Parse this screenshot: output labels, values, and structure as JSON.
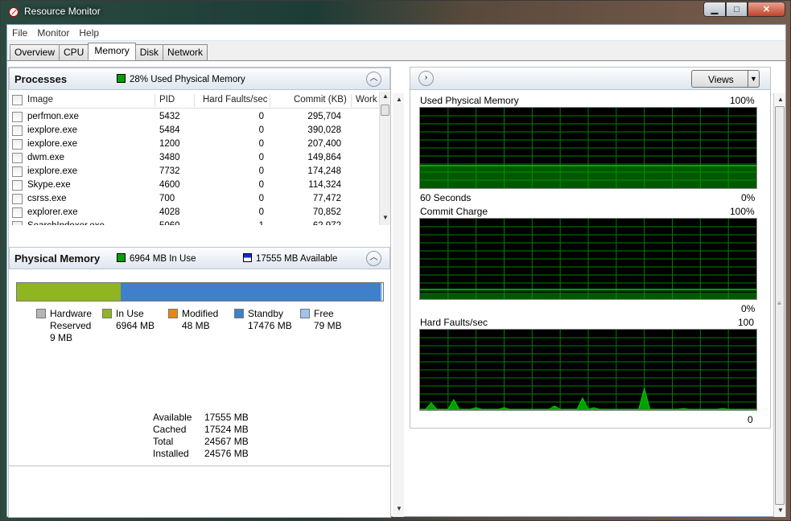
{
  "window": {
    "title": "Resource Monitor",
    "minimize": "▁",
    "maximize": "□",
    "close": "✕"
  },
  "menu": [
    "File",
    "Monitor",
    "Help"
  ],
  "tabs": [
    "Overview",
    "CPU",
    "Memory",
    "Disk",
    "Network"
  ],
  "active_tab": "Memory",
  "processes": {
    "title": "Processes",
    "summary": "28% Used Physical Memory",
    "summary_color": "#00a000",
    "columns": [
      "Image",
      "PID",
      "Hard Faults/sec",
      "Commit (KB)",
      "Work"
    ],
    "rows": [
      {
        "image": "perfmon.exe",
        "pid": "5432",
        "faults": "0",
        "commit": "295,704"
      },
      {
        "image": "iexplore.exe",
        "pid": "5484",
        "faults": "0",
        "commit": "390,028"
      },
      {
        "image": "iexplore.exe",
        "pid": "1200",
        "faults": "0",
        "commit": "207,400"
      },
      {
        "image": "dwm.exe",
        "pid": "3480",
        "faults": "0",
        "commit": "149,864"
      },
      {
        "image": "iexplore.exe",
        "pid": "7732",
        "faults": "0",
        "commit": "174,248"
      },
      {
        "image": "Skype.exe",
        "pid": "4600",
        "faults": "0",
        "commit": "114,324"
      },
      {
        "image": "csrss.exe",
        "pid": "700",
        "faults": "0",
        "commit": "77,472"
      },
      {
        "image": "explorer.exe",
        "pid": "4028",
        "faults": "0",
        "commit": "70,852"
      },
      {
        "image": "SearchIndexer.exe",
        "pid": "5060",
        "faults": "1",
        "commit": "62,972"
      }
    ]
  },
  "physical_memory": {
    "title": "Physical Memory",
    "in_use_summary": "6964 MB In Use",
    "available_summary": "17555 MB Available",
    "bar": {
      "in_use_fraction": 0.283,
      "standby_fraction": 0.711,
      "free_fraction": 0.003,
      "reserved_fraction": 0.0004
    },
    "legend": [
      {
        "label": "Hardware",
        "label2": "Reserved",
        "value": "9 MB",
        "color": "#b5b5b5"
      },
      {
        "label": "In Use",
        "label2": "",
        "value": "6964 MB",
        "color": "#8fb521"
      },
      {
        "label": "Modified",
        "label2": "",
        "value": "48 MB",
        "color": "#e8860f"
      },
      {
        "label": "Standby",
        "label2": "",
        "value": "17476 MB",
        "color": "#3f7fcc"
      },
      {
        "label": "Free",
        "label2": "",
        "value": "79 MB",
        "color": "#9fc4ef"
      }
    ],
    "summary_rows": [
      {
        "key": "Available",
        "value": "17555 MB"
      },
      {
        "key": "Cached",
        "value": "17524 MB"
      },
      {
        "key": "Total",
        "value": "24567 MB"
      },
      {
        "key": "Installed",
        "value": "24576 MB"
      }
    ]
  },
  "graphs_panel": {
    "views_label": "Views",
    "graphs": [
      {
        "title": "Used Physical Memory",
        "max_label": "100%",
        "min_label": "0%",
        "footer": "60 Seconds",
        "level_fraction": 0.28,
        "line_fraction": 0.28
      },
      {
        "title": "Commit Charge",
        "max_label": "100%",
        "min_label": "0%",
        "footer": "",
        "level_fraction": 0.08,
        "line_fraction": 0.12
      },
      {
        "title": "Hard Faults/sec",
        "max_label": "100",
        "min_label": "0",
        "footer": "",
        "spikes": [
          0,
          0,
          8,
          0,
          0,
          0,
          12,
          0,
          0,
          0,
          2,
          0,
          0,
          0,
          0,
          2,
          0,
          0,
          0,
          0,
          0,
          0,
          0,
          0,
          4,
          0,
          0,
          0,
          0,
          14,
          0,
          2,
          0,
          0,
          0,
          0,
          0,
          0,
          0,
          0,
          26,
          0,
          0,
          0,
          0,
          0,
          0,
          1,
          0,
          0,
          0,
          0,
          0,
          0,
          1,
          0,
          0,
          0,
          0,
          0,
          0
        ]
      }
    ],
    "accent_green": "#00d000",
    "grid_green": "#008000"
  }
}
